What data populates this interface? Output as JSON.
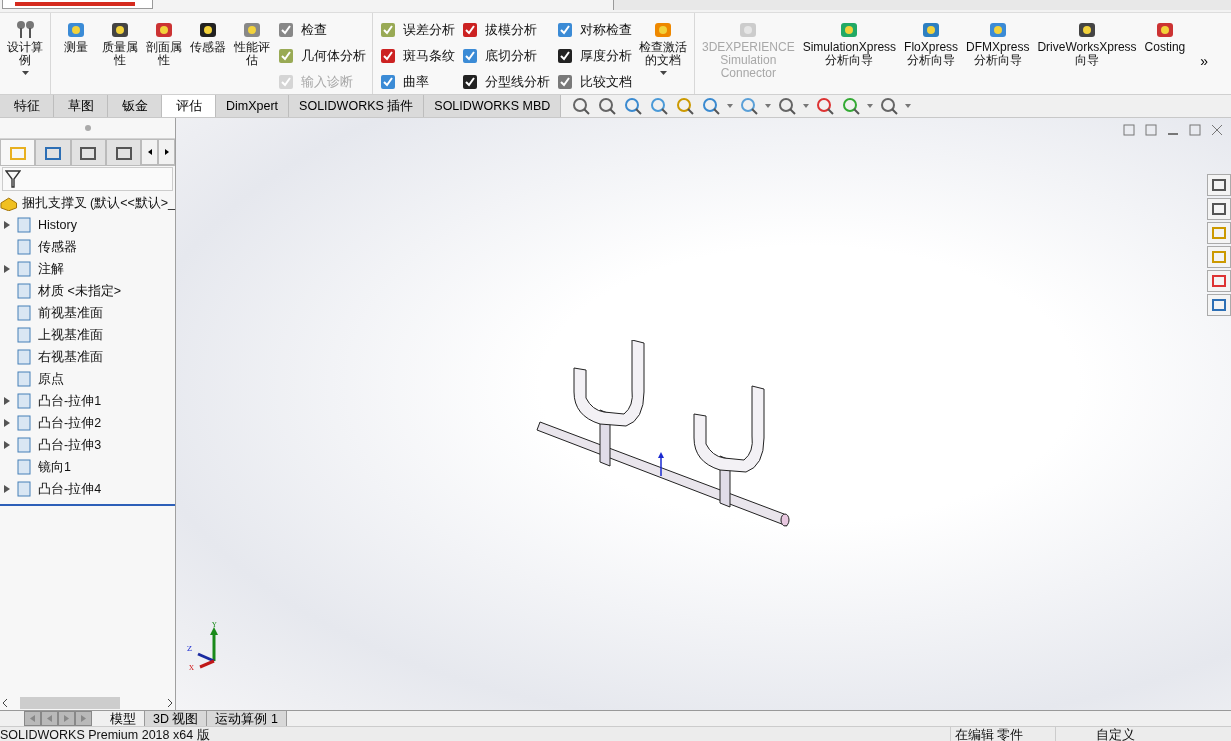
{
  "ribbon": {
    "sections": [
      {
        "items": [
          {
            "kind": "large",
            "label": "设计算例",
            "dropdown": true,
            "disabled": false
          }
        ]
      },
      {
        "items": [
          {
            "kind": "large",
            "label": "测量",
            "dropdown": false,
            "disabled": false
          },
          {
            "kind": "large",
            "label": "质量属性",
            "dropdown": false,
            "disabled": false
          },
          {
            "kind": "large",
            "label": "剖面属性",
            "dropdown": false,
            "disabled": false
          },
          {
            "kind": "large",
            "label": "传感器",
            "dropdown": false,
            "disabled": false
          },
          {
            "kind": "large",
            "label": "性能评估",
            "dropdown": false,
            "disabled": false
          },
          {
            "kind": "column",
            "rows": [
              {
                "label": "检查",
                "disabled": false
              },
              {
                "label": "几何体分析",
                "disabled": false
              },
              {
                "label": "输入诊断",
                "disabled": true
              }
            ]
          }
        ]
      },
      {
        "items": [
          {
            "kind": "column",
            "rows": [
              {
                "label": "误差分析",
                "disabled": false
              },
              {
                "label": "斑马条纹",
                "disabled": false
              },
              {
                "label": "曲率",
                "disabled": false
              }
            ]
          },
          {
            "kind": "column",
            "rows": [
              {
                "label": "拔模分析",
                "disabled": false
              },
              {
                "label": "底切分析",
                "disabled": false
              },
              {
                "label": "分型线分析",
                "disabled": false
              }
            ]
          },
          {
            "kind": "column",
            "rows": [
              {
                "label": "对称检查",
                "disabled": false
              },
              {
                "label": "厚度分析",
                "disabled": false
              },
              {
                "label": "比较文档",
                "disabled": false
              }
            ]
          },
          {
            "kind": "large",
            "label": "检查激活的文档",
            "dropdown": true,
            "disabled": false
          }
        ]
      },
      {
        "items": [
          {
            "kind": "large",
            "label": "3DEXPERIENCE\nSimulation\nConnector",
            "dropdown": false,
            "disabled": true
          },
          {
            "kind": "large",
            "label": "SimulationXpress\n分析向导",
            "dropdown": false,
            "disabled": false
          },
          {
            "kind": "large",
            "label": "FloXpress\n分析向导",
            "dropdown": false,
            "disabled": false
          },
          {
            "kind": "large",
            "label": "DFMXpress\n分析向导",
            "dropdown": false,
            "disabled": false
          },
          {
            "kind": "large",
            "label": "DriveWorksXpress\n向导",
            "dropdown": false,
            "disabled": false
          },
          {
            "kind": "large",
            "label": "Costing",
            "dropdown": false,
            "disabled": false
          }
        ]
      }
    ],
    "more": "»"
  },
  "command_tabs": [
    {
      "label": "特征",
      "selected": false
    },
    {
      "label": "草图",
      "selected": false
    },
    {
      "label": "钣金",
      "selected": false
    },
    {
      "label": "评估",
      "selected": true
    },
    {
      "label": "DimXpert",
      "selected": false
    },
    {
      "label": "SOLIDWORKS 插件",
      "selected": false
    },
    {
      "label": "SOLIDWORKS MBD",
      "selected": false
    }
  ],
  "panel_tabs": [
    {
      "selected": true
    },
    {
      "selected": false
    },
    {
      "selected": false
    },
    {
      "selected": false
    }
  ],
  "feature_tree": {
    "root": "捆扎支撑叉 (默认<<默认>_",
    "items": [
      {
        "label": "History",
        "expander": true
      },
      {
        "label": "传感器",
        "expander": false
      },
      {
        "label": "注解",
        "expander": true
      },
      {
        "label": "材质 <未指定>",
        "expander": false
      },
      {
        "label": "前视基准面",
        "expander": false
      },
      {
        "label": "上视基准面",
        "expander": false
      },
      {
        "label": "右视基准面",
        "expander": false
      },
      {
        "label": "原点",
        "expander": false
      },
      {
        "label": "凸台-拉伸1",
        "expander": true
      },
      {
        "label": "凸台-拉伸2",
        "expander": true
      },
      {
        "label": "凸台-拉伸3",
        "expander": true
      },
      {
        "label": "镜向1",
        "expander": false
      },
      {
        "label": "凸台-拉伸4",
        "expander": true
      }
    ]
  },
  "triad": {
    "y": "Y",
    "z": "Z",
    "x": "X"
  },
  "bottom_tabs": [
    {
      "label": "模型",
      "selected": true
    },
    {
      "label": "3D 视图",
      "selected": false
    },
    {
      "label": "运动算例 1",
      "selected": false
    }
  ],
  "status_bar": {
    "product": "SOLIDWORKS Premium 2018 x64 版",
    "mode": "在编辑 零件",
    "units": "自定义"
  }
}
